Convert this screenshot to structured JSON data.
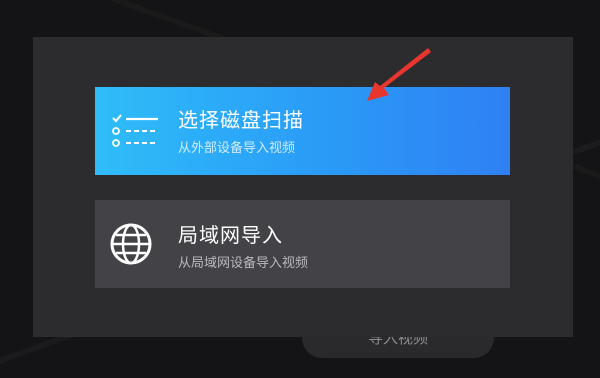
{
  "background": {
    "button_label": "导入视频"
  },
  "dialog": {
    "options": [
      {
        "title": "选择磁盘扫描",
        "subtitle": "从外部设备导入视频",
        "icon": "list-scan-icon",
        "accent_start": "#2fbdf8",
        "accent_end": "#2f80f3"
      },
      {
        "title": "局域网导入",
        "subtitle": "从局域网设备导入视频",
        "icon": "globe-icon",
        "accent": "#434347"
      }
    ]
  },
  "annotation": {
    "icon": "red-arrow-icon",
    "color": "#e8362f"
  }
}
